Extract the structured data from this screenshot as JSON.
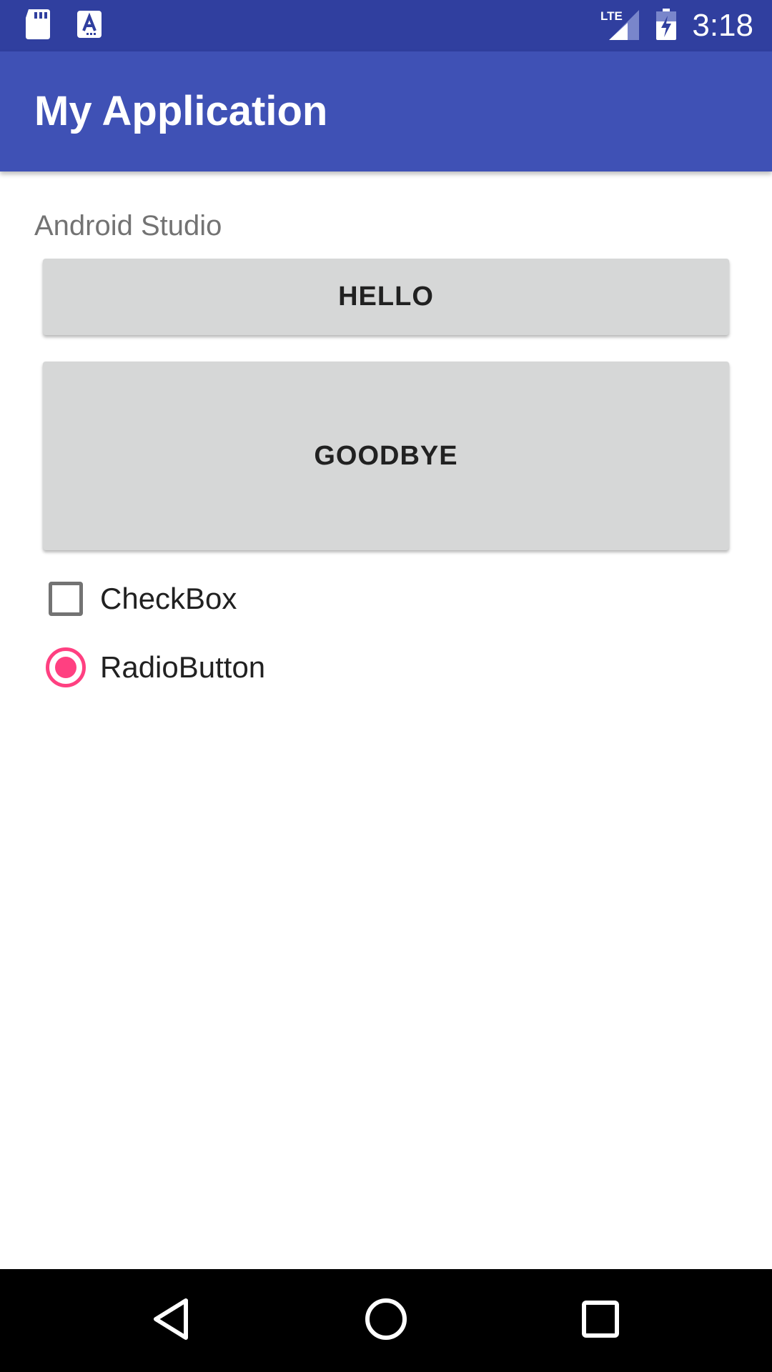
{
  "status_bar": {
    "time": "3:18",
    "network_label": "LTE",
    "icons": [
      "sd-card-icon",
      "text-a-icon",
      "lte-signal-icon",
      "battery-charging-icon"
    ]
  },
  "app_bar": {
    "title": "My Application"
  },
  "main": {
    "subtitle": "Android Studio",
    "hello_button_label": "HELLO",
    "goodbye_button_label": "GOODBYE",
    "checkbox": {
      "label": "CheckBox",
      "checked": false
    },
    "radio": {
      "label": "RadioButton",
      "selected": true
    }
  },
  "nav_bar": {
    "icons": [
      "back-icon",
      "home-icon",
      "recents-icon"
    ]
  },
  "colors": {
    "status_bar": "#303f9f",
    "app_bar": "#3f51b5",
    "accent": "#ff4081",
    "button_bg": "#d6d7d7"
  }
}
